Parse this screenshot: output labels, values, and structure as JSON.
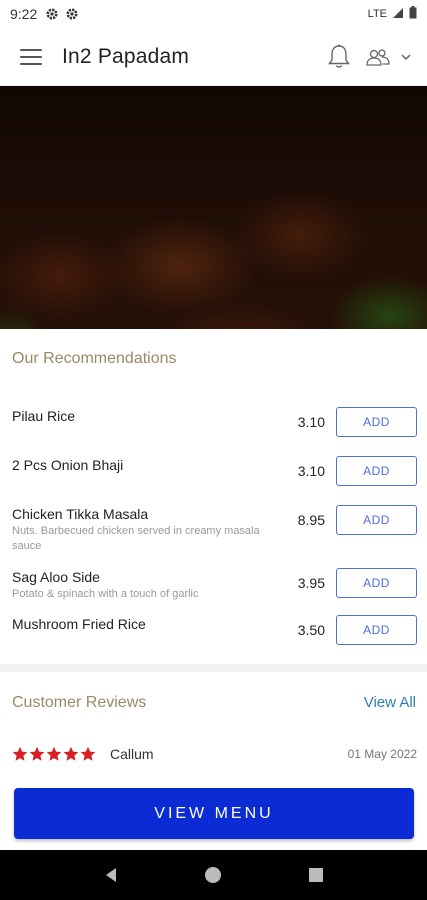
{
  "status_bar": {
    "time": "9:22",
    "network": "LTE"
  },
  "app_bar": {
    "title": "In2 Papadam"
  },
  "recommendations": {
    "title": "Our Recommendations",
    "add_label": "ADD",
    "items": [
      {
        "name": "Pilau Rice",
        "price": "3.10",
        "description": ""
      },
      {
        "name": "2 Pcs Onion Bhaji",
        "price": "3.10",
        "description": ""
      },
      {
        "name": "Chicken Tikka Masala",
        "price": "8.95",
        "description": "Nuts. Barbecued chicken served in creamy masala sauce"
      },
      {
        "name": "Sag Aloo Side",
        "price": "3.95",
        "description": "Potato & spinach with a touch of garlic"
      },
      {
        "name": "Mushroom Fried Rice",
        "price": "3.50",
        "description": ""
      }
    ]
  },
  "reviews": {
    "title": "Customer Reviews",
    "view_all": "View All",
    "items": [
      {
        "rating": 5,
        "name": "Callum",
        "date": "01 May 2022"
      }
    ]
  },
  "cta": {
    "view_menu": "VIEW MENU"
  },
  "colors": {
    "accent": "#0b2bd4",
    "add_button": "#4d6fd6",
    "star": "#d81f26",
    "section_title": "#9a8a63",
    "link": "#2a7fb8"
  }
}
